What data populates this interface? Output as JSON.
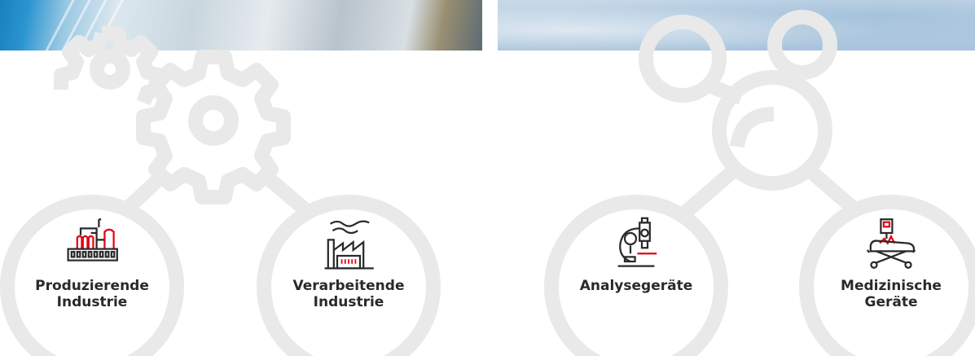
{
  "categories": [
    {
      "line1": "Produzierende",
      "line2": "Industrie",
      "icon": "factory-plant-icon"
    },
    {
      "line1": "Verarbeitende",
      "line2": "Industrie",
      "icon": "factory-smoke-icon"
    },
    {
      "line1": "Analysegeräte",
      "line2": "",
      "icon": "microscope-icon"
    },
    {
      "line1": "Medizinische",
      "line2": "Geräte",
      "icon": "hospital-bed-icon"
    }
  ],
  "colors": {
    "accent": "#e30613",
    "outline": "#2a2a2a",
    "ring": "#e9e9e9"
  }
}
